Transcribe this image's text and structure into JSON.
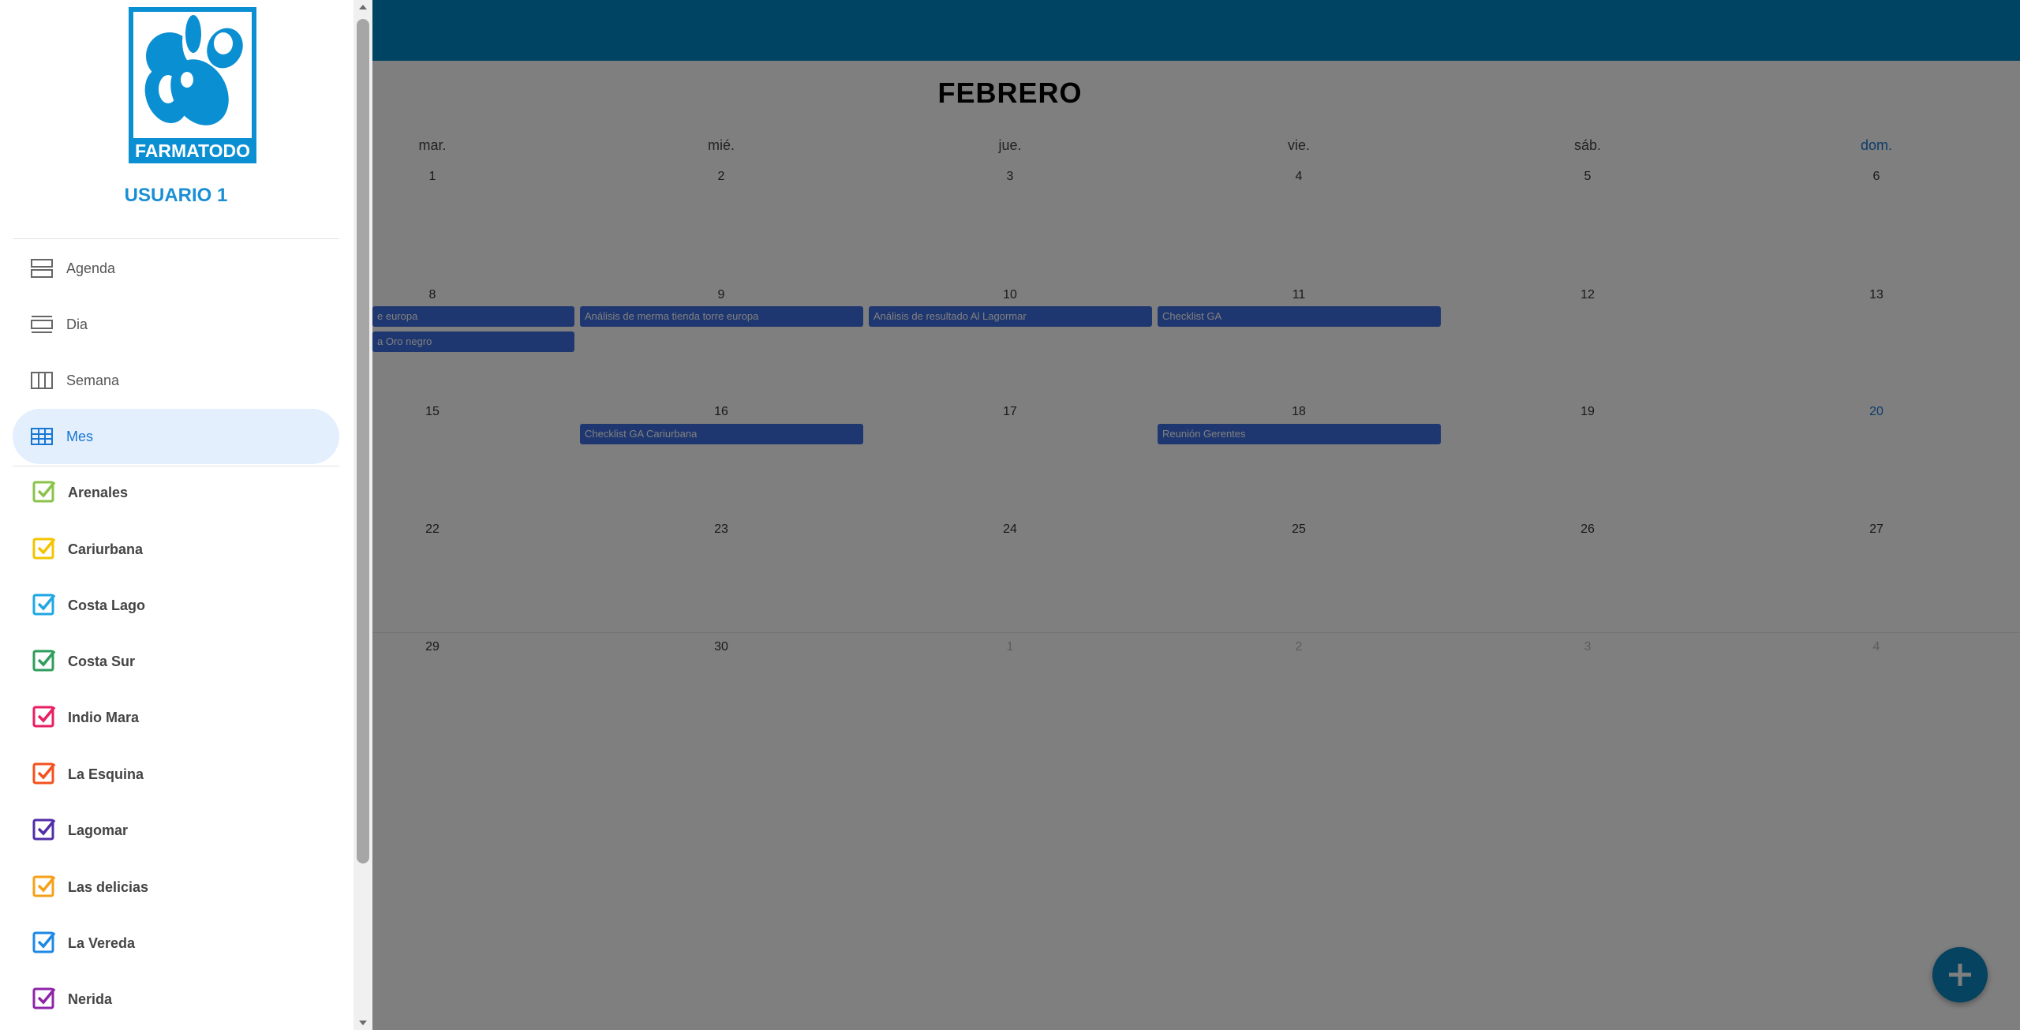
{
  "brand": {
    "logo_text": "FARMATODO",
    "color": "#0089c8"
  },
  "user": {
    "name": "USUARIO 1"
  },
  "nav": [
    {
      "label": "Agenda",
      "icon": "agenda-view-icon",
      "active": false
    },
    {
      "label": "Dia",
      "icon": "day-view-icon",
      "active": false
    },
    {
      "label": "Semana",
      "icon": "week-view-icon",
      "active": false
    },
    {
      "label": "Mes",
      "icon": "month-view-icon",
      "active": true
    }
  ],
  "stores": [
    {
      "label": "Arenales",
      "color": "#8bc34a"
    },
    {
      "label": "Cariurbana",
      "color": "#f4c400"
    },
    {
      "label": "Costa Lago",
      "color": "#1ea7e4"
    },
    {
      "label": "Costa Sur",
      "color": "#2e9e5b"
    },
    {
      "label": "Indio Mara",
      "color": "#e91e63"
    },
    {
      "label": "La Esquina",
      "color": "#f4511e"
    },
    {
      "label": "Lagomar",
      "color": "#512da8"
    },
    {
      "label": "Las delicias",
      "color": "#f6a01a"
    },
    {
      "label": "La Vereda",
      "color": "#1e88e5"
    },
    {
      "label": "Nerida",
      "color": "#8e24aa"
    }
  ],
  "calendar": {
    "month": "FEBRERO",
    "weekdays": [
      "mar.",
      "mié.",
      "jue.",
      "vie.",
      "sáb.",
      "dom."
    ],
    "weeks": [
      [
        "1",
        "2",
        "3",
        "4",
        "5",
        "6"
      ],
      [
        "8",
        "9",
        "10",
        "11",
        "12",
        "13"
      ],
      [
        "15",
        "16",
        "17",
        "18",
        "19",
        "20"
      ],
      [
        "22",
        "23",
        "24",
        "25",
        "26",
        "27"
      ],
      [
        "29",
        "30",
        "1",
        "2",
        "3",
        "4"
      ]
    ],
    "events": [
      {
        "label": "e europa",
        "week": 1,
        "col": 0,
        "row": 0
      },
      {
        "label": "a Oro negro",
        "week": 1,
        "col": 0,
        "row": 1
      },
      {
        "label": "Análisis de merma tienda torre europa",
        "week": 1,
        "col": 1,
        "row": 0
      },
      {
        "label": "Análisis de resultado Al Lagormar",
        "week": 1,
        "col": 2,
        "row": 0
      },
      {
        "label": "Checklist GA",
        "week": 1,
        "col": 3,
        "row": 0
      },
      {
        "label": "Checklist GA Cariurbana",
        "week": 2,
        "col": 1,
        "row": 0
      },
      {
        "label": "Reunión Gerentes",
        "week": 2,
        "col": 3,
        "row": 0
      }
    ],
    "add_button_icon": "plus-icon"
  }
}
